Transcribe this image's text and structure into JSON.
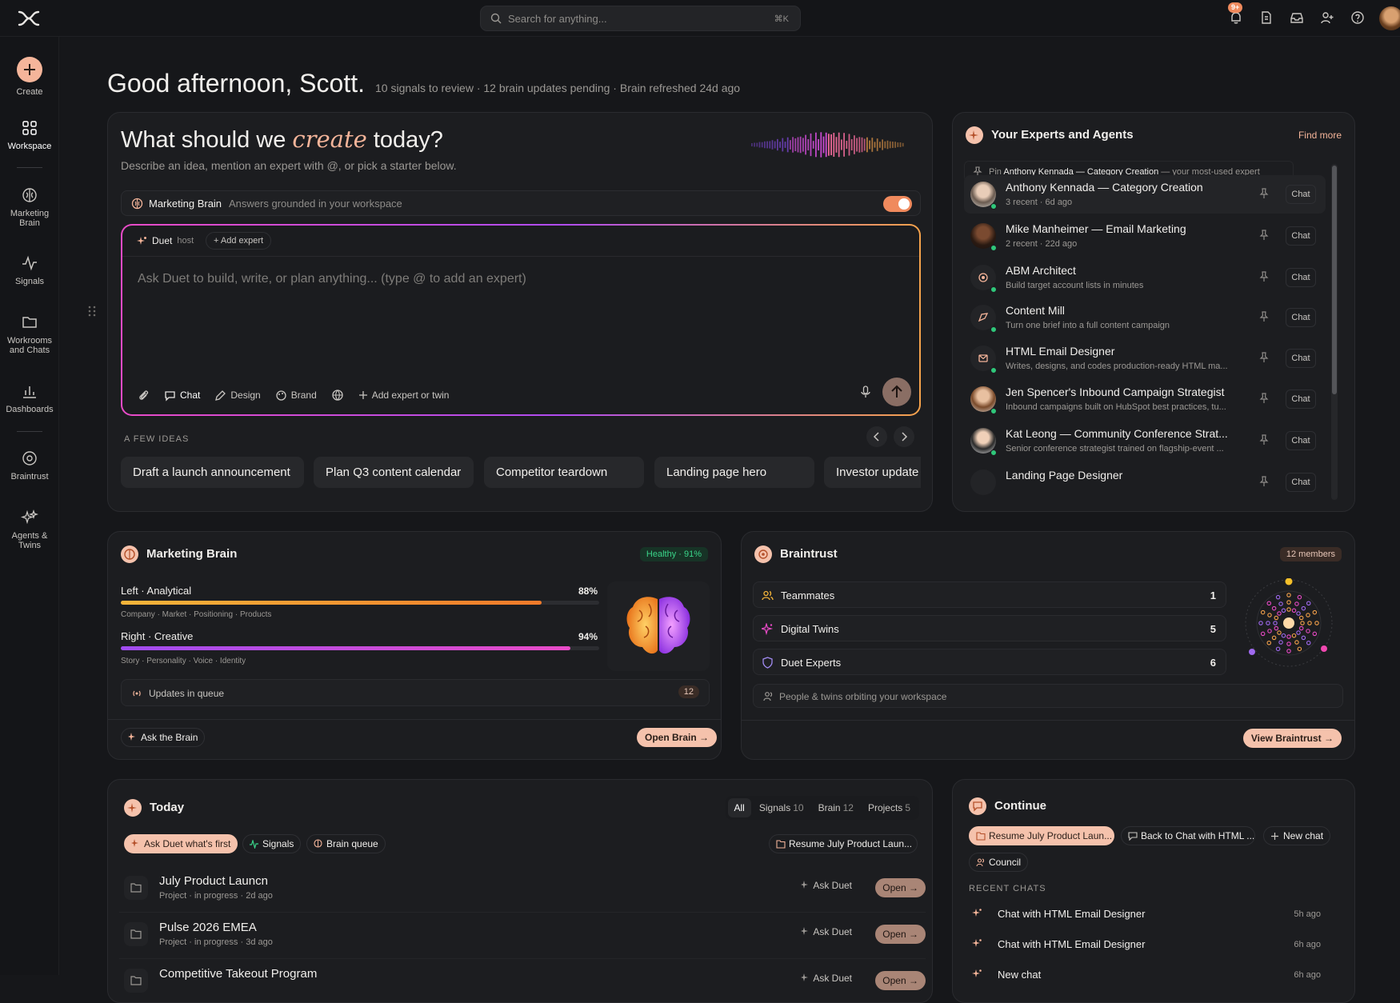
{
  "topbar": {
    "search_placeholder": "Search for anything...",
    "search_shortcut": "⌘K",
    "notifications_badge": "9+"
  },
  "sidebar": {
    "items": [
      {
        "label": "Create"
      },
      {
        "label": "Workspace"
      },
      {
        "label": "Marketing Brain"
      },
      {
        "label": "Signals"
      },
      {
        "label": "Workrooms and Chats"
      },
      {
        "label": "Dashboards"
      },
      {
        "label": "Braintrust"
      },
      {
        "label": "Agents & Twins"
      }
    ]
  },
  "greeting": {
    "title": "Good afternoon, Scott.",
    "subtitle": "10 signals to review · 12 brain updates pending · Brain refreshed 24d ago"
  },
  "hero": {
    "title_pre": "What should we",
    "title_em": "create",
    "title_post": "today?",
    "subtitle": "Describe an idea, mention an expert with @, or pick a starter below.",
    "brain_name": "Marketing Brain",
    "brain_desc": "Answers grounded in your workspace",
    "brain_toggle_on": true
  },
  "composer": {
    "host_name": "Duet",
    "host_tag": "host",
    "add_expert": "+ Add expert",
    "placeholder": "Ask Duet to build, write, or plan anything... (type @ to add an expert)",
    "tools": [
      "Chat",
      "Design",
      "Brand"
    ],
    "add_expert_twin": "Add expert or twin"
  },
  "ideas": {
    "label": "A FEW IDEAS",
    "items": [
      "Draft a launch announcement",
      "Plan Q3 content calendar",
      "Competitor teardown",
      "Landing page hero",
      "Investor update"
    ]
  },
  "experts": {
    "title": "Your Experts and Agents",
    "find_more": "Find more",
    "pin_prefix": "Pin",
    "pin_name": "Anthony Kennada — Category Creation",
    "pin_suffix": "— your most-used expert",
    "chat_label": "Chat",
    "items": [
      {
        "name": "Anthony Kennada — Category Creation",
        "desc": "3 recent · 6d ago"
      },
      {
        "name": "Mike Manheimer — Email Marketing",
        "desc": "2 recent · 22d ago"
      },
      {
        "name": "ABM Architect",
        "desc": "Build target account lists in minutes"
      },
      {
        "name": "Content Mill",
        "desc": "Turn one brief into a full content campaign"
      },
      {
        "name": "HTML Email Designer",
        "desc": "Writes, designs, and codes production-ready HTML ma..."
      },
      {
        "name": "Jen Spencer's Inbound Campaign Strategist",
        "desc": "Inbound campaigns built on HubSpot best practices, tu..."
      },
      {
        "name": "Kat Leong — Community Conference Strat...",
        "desc": "Senior conference strategist trained on flagship-event ..."
      },
      {
        "name": "Landing Page Designer",
        "desc": ""
      }
    ]
  },
  "brain": {
    "title": "Marketing Brain",
    "health": "Healthy · 91%",
    "left_label": "Left · Analytical",
    "left_pct": "88%",
    "left_value": 88,
    "left_sub": "Company · Market · Positioning · Products",
    "right_label": "Right · Creative",
    "right_pct": "94%",
    "right_value": 94,
    "right_sub": "Story · Personality · Voice · Identity",
    "queue_label": "Updates in queue",
    "queue_count": "12",
    "ask": "Ask the Brain",
    "open": "Open Brain →"
  },
  "braintrust": {
    "title": "Braintrust",
    "members": "12 members",
    "rows": [
      {
        "label": "Teammates",
        "count": "1"
      },
      {
        "label": "Digital Twins",
        "count": "5"
      },
      {
        "label": "Duet Experts",
        "count": "6"
      }
    ],
    "orbit_note": "People & twins orbiting your workspace",
    "view": "View Braintrust →"
  },
  "today": {
    "title": "Today",
    "tabs": [
      {
        "label": "All",
        "count": ""
      },
      {
        "label": "Signals",
        "count": "10"
      },
      {
        "label": "Brain",
        "count": "12"
      },
      {
        "label": "Projects",
        "count": "5"
      }
    ],
    "chips": [
      "Ask Duet what's first",
      "Signals",
      "Brain queue"
    ],
    "resume": "Resume July Product Laun...",
    "ask_duet": "Ask Duet",
    "open": "Open →",
    "rows": [
      {
        "name": "July Product Launcn",
        "desc": "Project · in progress · 2d ago"
      },
      {
        "name": "Pulse 2026 EMEA",
        "desc": "Project · in progress · 3d ago"
      },
      {
        "name": "Competitive Takeout Program",
        "desc": ""
      }
    ]
  },
  "continue": {
    "title": "Continue",
    "chips": [
      "Resume July Product Laun...",
      "Back to Chat with HTML ...",
      "New chat",
      "Council"
    ],
    "recent_label": "RECENT CHATS",
    "recent": [
      {
        "label": "Chat with HTML Email Designer",
        "time": "5h ago"
      },
      {
        "label": "Chat with HTML Email Designer",
        "time": "6h ago"
      },
      {
        "label": "New chat",
        "time": "6h ago"
      }
    ]
  },
  "colors": {
    "accent": "#f5b59a",
    "brand_orange": "#f08a5d",
    "healthy": "#2fc77a",
    "magenta": "#e94bc7"
  }
}
